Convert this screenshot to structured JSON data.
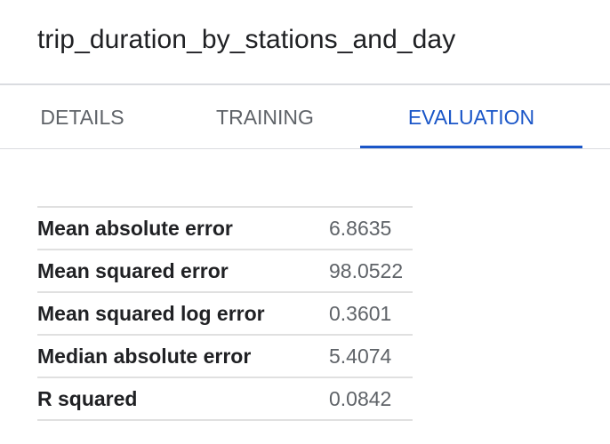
{
  "model": {
    "title": "trip_duration_by_stations_and_day"
  },
  "tabs": [
    {
      "label": "DETAILS",
      "active": false
    },
    {
      "label": "TRAINING",
      "active": false
    },
    {
      "label": "EVALUATION",
      "active": true
    }
  ],
  "metrics": [
    {
      "name": "Mean absolute error",
      "value": "6.8635"
    },
    {
      "name": "Mean squared error",
      "value": "98.0522"
    },
    {
      "name": "Mean squared log error",
      "value": "0.3601"
    },
    {
      "name": "Median absolute error",
      "value": "5.4074"
    },
    {
      "name": "R squared",
      "value": "0.0842"
    }
  ],
  "colors": {
    "accent": "#1a56c8",
    "text_primary": "#202124",
    "text_secondary": "#5f6368",
    "divider": "#dadce0"
  }
}
